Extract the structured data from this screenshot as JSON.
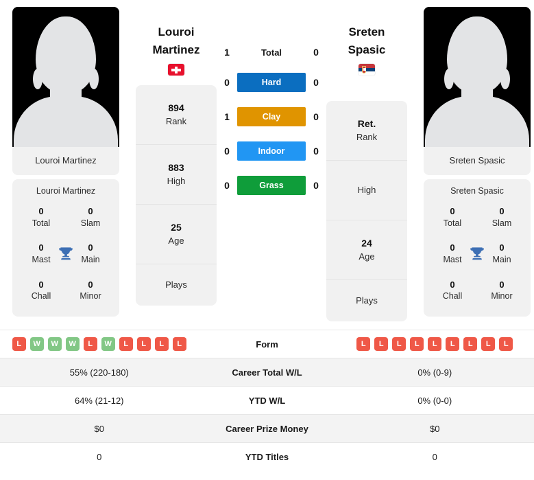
{
  "colors": {
    "hard": "#0b6ec0",
    "clay": "#e09400",
    "indoor": "#2196f3",
    "grass": "#0f9d3a",
    "win": "#82c785",
    "loss": "#ef5847",
    "trophy": "#3d6fb4",
    "card_bg": "#f1f1f1",
    "row_shaded": "#f3f3f3"
  },
  "players": {
    "left": {
      "name_full": "Louroi Martinez",
      "name_line1": "Louroi",
      "name_line2": "Martinez",
      "country_flag": "swiss-flag",
      "photo": "player-photo-placeholder",
      "stats": [
        {
          "value": "894",
          "label": "Rank"
        },
        {
          "value": "883",
          "label": "High"
        },
        {
          "value": "25",
          "label": "Age"
        },
        {
          "value": "",
          "label": "Plays"
        }
      ],
      "titles": [
        {
          "value": "0",
          "label": "Total"
        },
        {
          "value": "0",
          "label": "Slam"
        },
        {
          "value": "0",
          "label": "Mast"
        },
        {
          "value": "0",
          "label": "Main"
        },
        {
          "value": "0",
          "label": "Chall"
        },
        {
          "value": "0",
          "label": "Minor"
        }
      ],
      "form": [
        "L",
        "W",
        "W",
        "W",
        "L",
        "W",
        "L",
        "L",
        "L",
        "L"
      ],
      "career_total_wl": "55% (220-180)",
      "ytd_wl": "64% (21-12)",
      "career_prize_money": "$0",
      "ytd_titles": "0"
    },
    "right": {
      "name_full": "Sreten Spasic",
      "name_line1": "Sreten",
      "name_line2": "Spasic",
      "country_flag": "serbia-flag",
      "photo": "player-photo-placeholder",
      "stats": [
        {
          "value": "Ret.",
          "label": "Rank"
        },
        {
          "value": "",
          "label": "High"
        },
        {
          "value": "24",
          "label": "Age"
        },
        {
          "value": "",
          "label": "Plays"
        }
      ],
      "titles": [
        {
          "value": "0",
          "label": "Total"
        },
        {
          "value": "0",
          "label": "Slam"
        },
        {
          "value": "0",
          "label": "Mast"
        },
        {
          "value": "0",
          "label": "Main"
        },
        {
          "value": "0",
          "label": "Chall"
        },
        {
          "value": "0",
          "label": "Minor"
        }
      ],
      "form": [
        "L",
        "L",
        "L",
        "L",
        "L",
        "L",
        "L",
        "L",
        "L"
      ],
      "career_total_wl": "0% (0-9)",
      "ytd_wl": "0% (0-0)",
      "career_prize_money": "$0",
      "ytd_titles": "0"
    }
  },
  "head_to_head": [
    {
      "label": "Total",
      "left": "1",
      "right": "0",
      "style": "plain",
      "color": ""
    },
    {
      "label": "Hard",
      "left": "0",
      "right": "0",
      "style": "badge",
      "color": "#0b6ec0"
    },
    {
      "label": "Clay",
      "left": "1",
      "right": "0",
      "style": "badge",
      "color": "#e09400"
    },
    {
      "label": "Indoor",
      "left": "0",
      "right": "0",
      "style": "badge",
      "color": "#2196f3"
    },
    {
      "label": "Grass",
      "left": "0",
      "right": "0",
      "style": "badge",
      "color": "#0f9d3a"
    }
  ],
  "comparison_rows": [
    {
      "label": "Form",
      "type": "form",
      "shaded": false
    },
    {
      "label": "Career Total W/L",
      "type": "text",
      "shaded": true,
      "left": "55% (220-180)",
      "right": "0% (0-9)"
    },
    {
      "label": "YTD W/L",
      "type": "text",
      "shaded": false,
      "left": "64% (21-12)",
      "right": "0% (0-0)"
    },
    {
      "label": "Career Prize Money",
      "type": "text",
      "shaded": true,
      "left": "$0",
      "right": "$0"
    },
    {
      "label": "YTD Titles",
      "type": "text",
      "shaded": false,
      "left": "0",
      "right": "0"
    }
  ]
}
